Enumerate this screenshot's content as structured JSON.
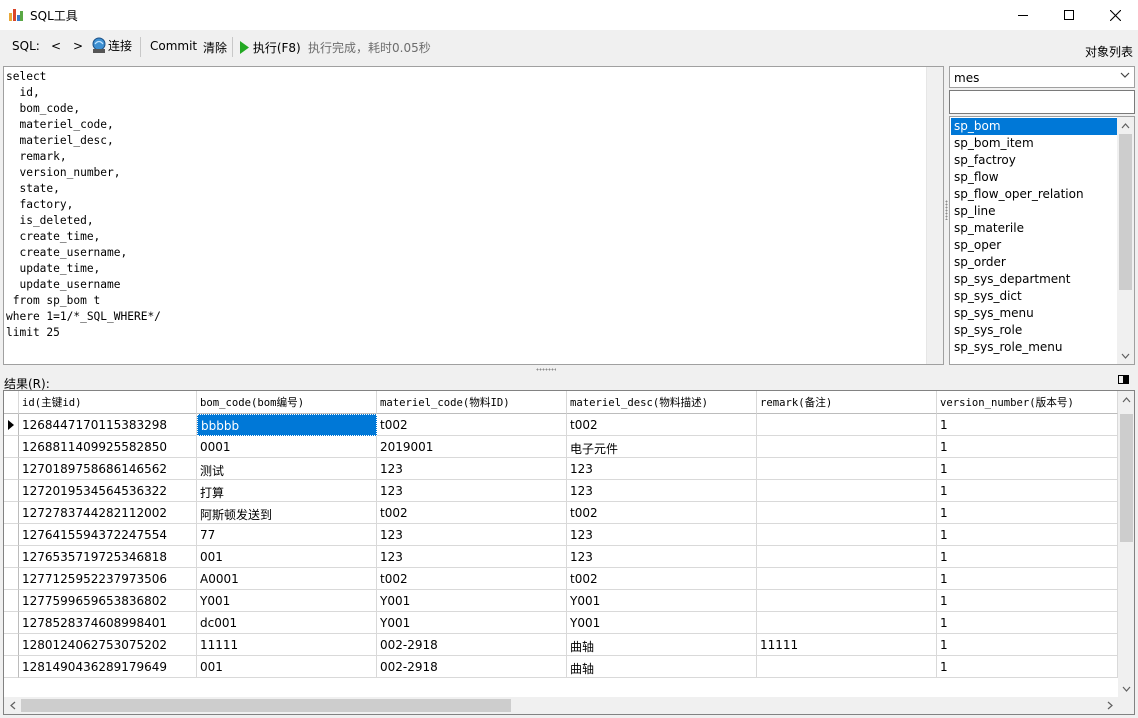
{
  "window": {
    "title": "SQL工具"
  },
  "toolbar": {
    "sql_label": "SQL:",
    "prev_label": "<",
    "next_label": ">",
    "connect_label": "连接",
    "commit_label": "Commit",
    "clear_label": "清除",
    "execute_label": "执行(F8)",
    "status": "执行完成，耗时0.05秒"
  },
  "editor": {
    "sql": "select\n  id,\n  bom_code,\n  materiel_code,\n  materiel_desc,\n  remark,\n  version_number,\n  state,\n  factory,\n  is_deleted,\n  create_time,\n  create_username,\n  update_time,\n  update_username\n from sp_bom t\nwhere 1=1/*_SQL_WHERE*/\nlimit 25"
  },
  "objects": {
    "label": "对象列表",
    "database": "mes",
    "filter": "",
    "selected_index": 0,
    "items": [
      "sp_bom",
      "sp_bom_item",
      "sp_factroy",
      "sp_flow",
      "sp_flow_oper_relation",
      "sp_line",
      "sp_materile",
      "sp_oper",
      "sp_order",
      "sp_sys_department",
      "sp_sys_dict",
      "sp_sys_menu",
      "sp_sys_role",
      "sp_sys_role_menu"
    ]
  },
  "results": {
    "label": "结果(R):",
    "columns": [
      "id(主键id)",
      "bom_code(bom编号)",
      "materiel_code(物料ID)",
      "materiel_desc(物料描述)",
      "remark(备注)",
      "version_number(版本号)"
    ],
    "rows": [
      [
        "1268447170115383298",
        "bbbbb",
        "t002",
        "t002",
        "",
        "1"
      ],
      [
        "1268811409925582850",
        "0001",
        "2019001",
        "电子元件",
        "",
        "1"
      ],
      [
        "1270189758686146562",
        "测试",
        "123",
        "123",
        "",
        "1"
      ],
      [
        "1272019534564536322",
        "打算",
        "123",
        "123",
        "",
        "1"
      ],
      [
        "1272783744282112002",
        "阿斯顿发送到",
        "t002",
        "t002",
        "",
        "1"
      ],
      [
        "1276415594372247554",
        "77",
        "123",
        "123",
        "",
        "1"
      ],
      [
        "1276535719725346818",
        "001",
        "123",
        "123",
        "",
        "1"
      ],
      [
        "1277125952237973506",
        "A0001",
        "t002",
        "t002",
        "",
        "1"
      ],
      [
        "1277599659653836802",
        "Y001",
        "Y001",
        "Y001",
        "",
        "1"
      ],
      [
        "1278528374608998401",
        "dc001",
        "Y001",
        "Y001",
        "",
        "1"
      ],
      [
        "1280124062753075202",
        "11111",
        "002-2918",
        "曲轴",
        "11111",
        "1"
      ],
      [
        "1281490436289179649",
        "001",
        "002-2918",
        "曲轴",
        "",
        "1"
      ]
    ],
    "current_row": 0,
    "current_col": 1
  },
  "colors": {
    "selection": "#0078d7",
    "play_green": "#22a822"
  }
}
